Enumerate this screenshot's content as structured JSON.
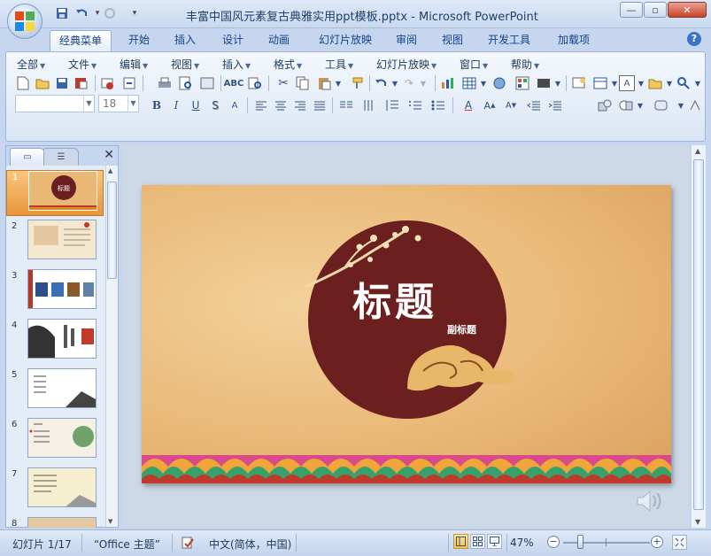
{
  "window": {
    "title": "丰富中国风元素复古典雅实用ppt模板.pptx - Microsoft PowerPoint",
    "minimize": "—",
    "maximize": "▫",
    "close": "✕"
  },
  "quick_access": {
    "save_icon": "save-icon",
    "undo_icon": "undo-icon",
    "redo_icon": "redo-icon",
    "customize": "▾"
  },
  "tabs": [
    "经典菜单",
    "开始",
    "插入",
    "设计",
    "动画",
    "幻灯片放映",
    "审阅",
    "视图",
    "开发工具",
    "加载项"
  ],
  "help": "?",
  "classic_menu": [
    "全部",
    "文件",
    "编辑",
    "视图",
    "插入",
    "格式",
    "工具",
    "幻灯片放映",
    "窗口",
    "帮助"
  ],
  "toolbar": {
    "font_size": "18",
    "bold": "B",
    "italic": "I",
    "underline": "U",
    "shadow": "S",
    "strike": "A"
  },
  "slides": {
    "numbers": [
      "1",
      "2",
      "3",
      "4",
      "5",
      "6",
      "7",
      "8"
    ],
    "selected": "1"
  },
  "slide": {
    "title": "标题",
    "subtitle": "副标题"
  },
  "status": {
    "slide_info": "幻灯片 1/17",
    "theme": "“Office 主题”",
    "language": "中文(简体，中国)",
    "zoom": "47%",
    "zoom_level": 0.47
  },
  "colors": {
    "ribbon_bg": "#dbe6f4",
    "accent": "#15428b",
    "slide_bg": "#e9b877",
    "circle": "#6b1f1e",
    "selected_thumb": "#e8963d"
  }
}
